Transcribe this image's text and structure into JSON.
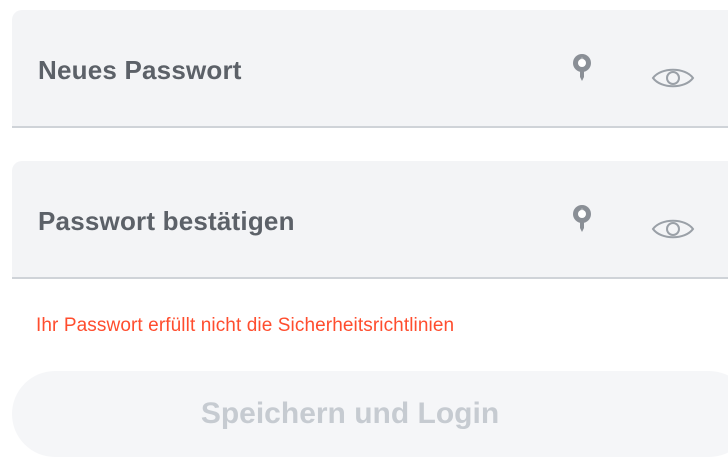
{
  "form": {
    "new_password": {
      "label": "Neues Passwort"
    },
    "confirm_password": {
      "label": "Passwort bestätigen"
    },
    "error_message": "Ihr Passwort erfüllt nicht die Sicherheitsrichtlinien",
    "submit_label": "Speichern und Login"
  },
  "icons": {
    "key": "password-manager-key-icon",
    "eye": "eye-icon"
  },
  "colors": {
    "field_background": "#f3f4f6",
    "field_border": "#cfd3d8",
    "label_text": "#5c6168",
    "icon_gray": "#8a8f96",
    "error_text": "#ff4d2e",
    "button_background": "#f5f6f8",
    "button_text_disabled": "#c6cbd1"
  }
}
